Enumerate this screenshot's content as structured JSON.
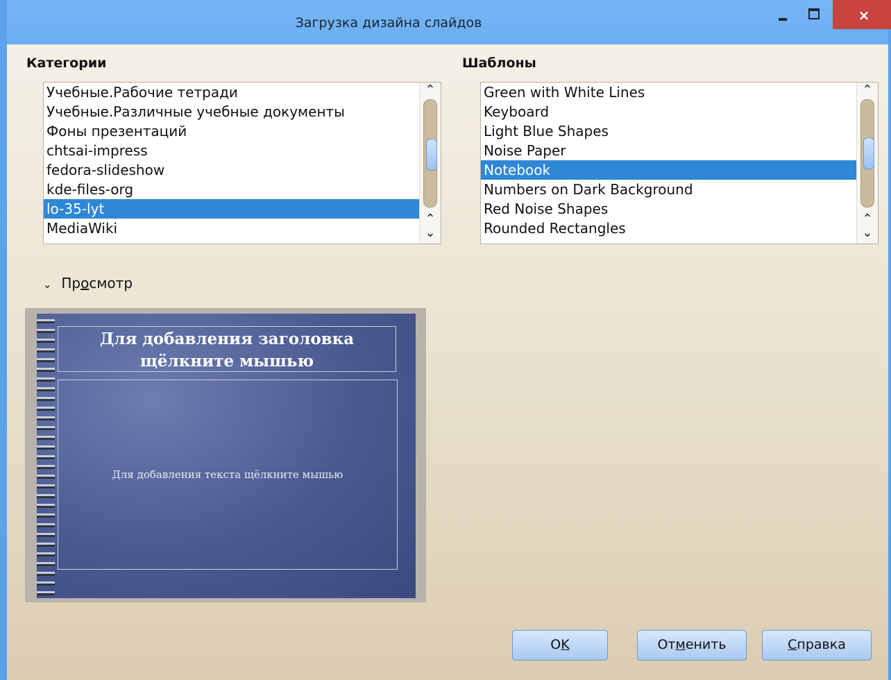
{
  "window": {
    "title": "Загрузка дизайна слайдов",
    "close_glyph": "×"
  },
  "categories": {
    "label": "Категории",
    "items": [
      "Учебные.Рабочие тетради",
      "Учебные.Различные учебные документы",
      "Фоны презентаций",
      "chtsai-impress",
      "fedora-slideshow",
      "kde-files-org",
      "lo-35-lyt",
      "MediaWiki"
    ],
    "selected": "lo-35-lyt",
    "scroll_position": 0.52
  },
  "templates": {
    "label": "Шаблоны",
    "items": [
      "Green with White Lines",
      "Keyboard",
      "Light Blue Shapes",
      "Noise Paper",
      "Notebook",
      "Numbers on Dark Background",
      "Red Noise Shapes",
      "Rounded Rectangles"
    ],
    "selected": "Notebook",
    "scroll_position": 0.5
  },
  "preview": {
    "label_before": "Пр",
    "label_mnemonic": "о",
    "label_after": "смотр",
    "slide_title_line1": "Для добавления заголовка",
    "slide_title_line2": "щёлкните мышью",
    "slide_body": "Для добавления текста щёлкните мышью"
  },
  "buttons": {
    "ok_before": "O",
    "ok_mnemonic": "K",
    "ok_after": "",
    "cancel_before": "От",
    "cancel_mnemonic": "м",
    "cancel_after": "енить",
    "help_before": "",
    "help_mnemonic": "С",
    "help_after": "правка"
  },
  "icons": [
    "minimize-icon",
    "maximize-icon",
    "close-icon",
    "scroll-up-icon",
    "scroll-down-icon",
    "chevron-down-icon"
  ],
  "colors": {
    "selection": "#2f87d7",
    "titlebar": "#6aaef1",
    "close": "#c8433b"
  }
}
